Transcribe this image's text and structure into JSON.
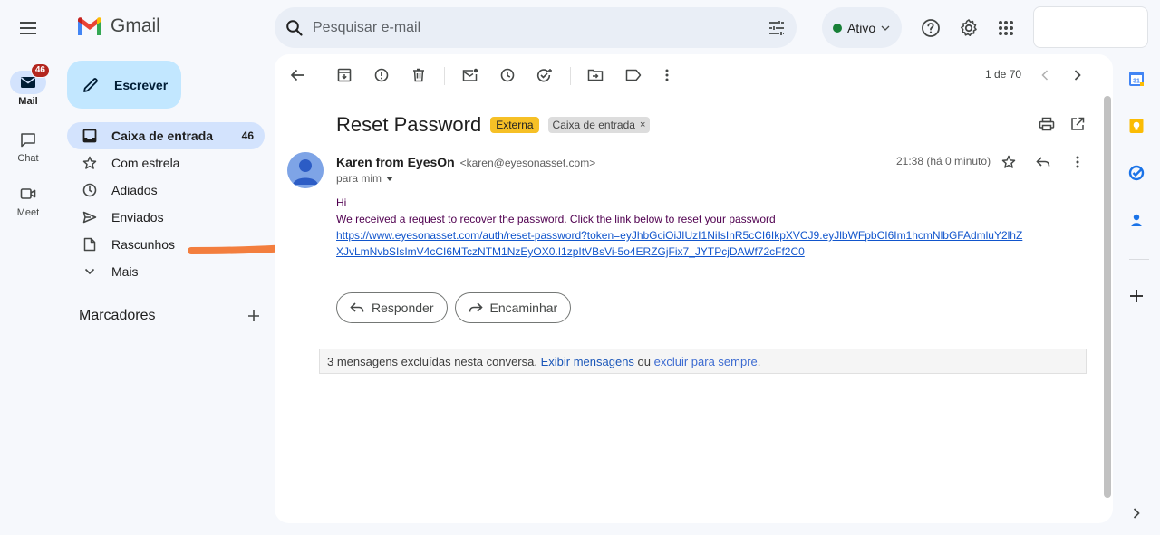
{
  "app": {
    "name": "Gmail"
  },
  "rail": {
    "mail": {
      "label": "Mail",
      "badge": "46"
    },
    "chat": {
      "label": "Chat"
    },
    "meet": {
      "label": "Meet"
    }
  },
  "search": {
    "placeholder": "Pesquisar e-mail"
  },
  "status": {
    "label": "Ativo",
    "color": "#188038"
  },
  "compose": {
    "label": "Escrever"
  },
  "nav": {
    "items": [
      {
        "label": "Caixa de entrada",
        "count": "46",
        "icon": "inbox-icon"
      },
      {
        "label": "Com estrela",
        "icon": "star-icon"
      },
      {
        "label": "Adiados",
        "icon": "clock-icon"
      },
      {
        "label": "Enviados",
        "icon": "send-icon"
      },
      {
        "label": "Rascunhos",
        "icon": "draft-icon"
      },
      {
        "label": "Mais",
        "icon": "chevron-down-icon"
      }
    ],
    "labels_heading": "Marcadores"
  },
  "toolbar": {
    "pager": "1 de 70"
  },
  "message": {
    "subject": "Reset Password",
    "tags": {
      "external": "Externa",
      "inbox": "Caixa de entrada"
    },
    "sender_name": "Karen from EyesOn",
    "sender_email": "<karen@eyesonasset.com>",
    "to": "para mim",
    "time": "21:38 (há 0 minuto)",
    "body_greeting": "Hi",
    "body_text": "We received a request to recover the password. Click the link below to reset your password",
    "link": "https://www.eyesonasset.com/auth/reset-password?token=eyJhbGciOiJIUzI1NiIsInR5cCI6IkpXVCJ9.eyJlbWFpbCI6Im1hcmNlbGFAdmluY2lhZXJvLmNvbSIsImV4cCI6MTczNTM1NzEyOX0.I1zpItVBsVi-5o4ERZGjFix7_JYTPcjDAWf72cFf2C0"
  },
  "actions": {
    "reply": "Responder",
    "forward": "Encaminhar"
  },
  "deleted_notice": {
    "prefix": "3 mensagens excluídas nesta conversa. ",
    "show": "Exibir mensagens",
    "middle": " ou ",
    "delete": "excluir para sempre",
    "suffix": "."
  },
  "colors": {
    "accent": "#0b57d0",
    "compose_bg": "#c2e7ff",
    "active_nav": "#d3e3fd",
    "tag_external": "#f6c026",
    "arrow": "#f37e3e"
  }
}
